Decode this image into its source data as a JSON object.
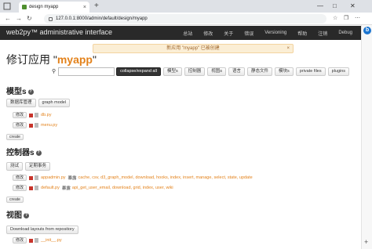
{
  "browser": {
    "tab_title": "design myapp",
    "tab_close": "×",
    "new_tab": "+",
    "url": "127.0.0.1:8000/admin/default/design/myapp",
    "minimize": "—",
    "maximize": "□",
    "close": "✕",
    "sidebar_plus": "+",
    "sidebar_logo": "b"
  },
  "appnav": {
    "brand": "web2py™ administrative interface",
    "items": [
      "总站",
      "修改",
      "关于",
      "错误",
      "Versioning",
      "帮助",
      "注销",
      "Debug"
    ]
  },
  "flash": {
    "message": "新应用 \"myapp\" 已被创建",
    "close": "×"
  },
  "page_title": {
    "prefix": "修订应用 \"",
    "app": "myapp",
    "suffix": "\""
  },
  "toolbar": {
    "search_placeholder": "",
    "buttons": [
      "collapse/expand all",
      "模型s",
      "控制器",
      "视图s",
      "语言",
      "静态文件",
      "模块s",
      "private files",
      "plugins"
    ]
  },
  "models": {
    "title": "模型s",
    "help": "?",
    "buttons": [
      "数据库管理",
      "graph model"
    ],
    "files": [
      {
        "edit": "修改",
        "name": "db.py"
      },
      {
        "edit": "修改",
        "name": "menu.py"
      }
    ],
    "create": "create"
  },
  "controllers": {
    "title": "控制器s",
    "help": "?",
    "buttons": [
      "测试",
      "定期事务"
    ],
    "files": [
      {
        "edit": "修改",
        "name": "appadmin.py",
        "exposes": "暴露",
        "functions": "cache, csv, d3_graph_model, download, hooks, index, insert, manage, select, state, update"
      },
      {
        "edit": "修改",
        "name": "default.py",
        "exposes": "暴露",
        "functions": "api_get_user_email, download, grid, index, user, wiki"
      }
    ],
    "create": "create"
  },
  "views": {
    "title": "视图",
    "help": "?",
    "buttons": [
      "Download layouts from repository"
    ],
    "files": [
      {
        "edit": "修改",
        "name": "__init__.py"
      }
    ]
  }
}
